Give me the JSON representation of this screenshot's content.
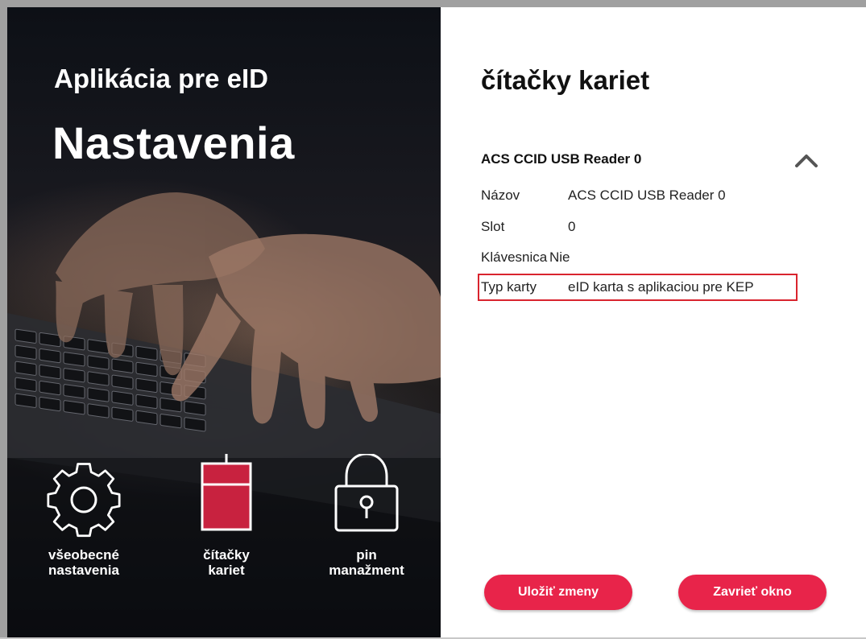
{
  "left": {
    "app_title": "Aplikácia pre eID",
    "heading": "Nastavenia",
    "nav": [
      {
        "icon": "gear-icon",
        "line1": "všeobecné",
        "line2": "nastavenia",
        "active": false
      },
      {
        "icon": "card-reader-icon",
        "line1": "čítačky",
        "line2": "kariet",
        "active": true,
        "color": "#c8223f"
      },
      {
        "icon": "lock-icon",
        "line1": "pin",
        "line2": "manažment",
        "active": false
      }
    ]
  },
  "right": {
    "title": "čítačky kariet",
    "reader": {
      "name": "ACS CCID USB Reader 0",
      "expanded": true,
      "rows": [
        {
          "label": "Názov",
          "value": "ACS CCID USB Reader 0"
        },
        {
          "label": "Slot",
          "value": "0"
        },
        {
          "label": "Klávesnica",
          "value": "Nie"
        },
        {
          "label": "Typ karty",
          "value": "eID karta s aplikaciou pre KEP",
          "highlighted": true
        }
      ]
    },
    "buttons": {
      "save": "Uložiť zmeny",
      "close": "Zavrieť okno"
    }
  },
  "colors": {
    "accent": "#e8244a",
    "highlight_border": "#d9242e",
    "active_icon": "#c8223f"
  }
}
